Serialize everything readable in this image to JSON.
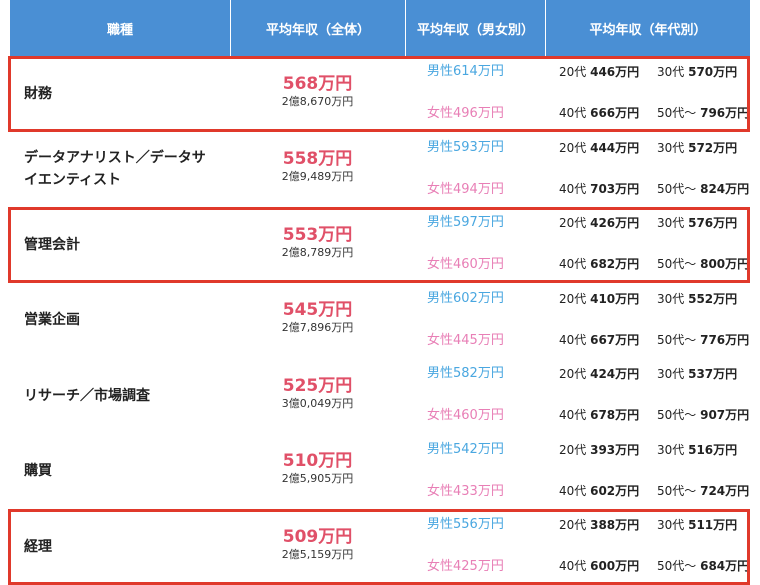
{
  "header": {
    "col1": "職種",
    "col2": "平均年収（全体）",
    "col3": "平均年収（男女別）",
    "col4": "平均年収（年代別）"
  },
  "highlight_color": "#e0392b",
  "header_color": "#4a8fd4",
  "rows": [
    {
      "name": "財務",
      "avg": "568万円",
      "lifetime": "2億8,670万円",
      "male": "男性614万円",
      "female": "女性496万円",
      "age20_label": "20代",
      "age20": "446万円",
      "age30_label": "30代",
      "age30": "570万円",
      "age40_label": "40代",
      "age40": "666万円",
      "age50_label": "50代〜",
      "age50": "796万円",
      "highlighted": true
    },
    {
      "name": "データアナリスト／データサイエンティスト",
      "avg": "558万円",
      "lifetime": "2億9,489万円",
      "male": "男性593万円",
      "female": "女性494万円",
      "age20_label": "20代",
      "age20": "444万円",
      "age30_label": "30代",
      "age30": "572万円",
      "age40_label": "40代",
      "age40": "703万円",
      "age50_label": "50代〜",
      "age50": "824万円",
      "highlighted": false
    },
    {
      "name": "管理会計",
      "avg": "553万円",
      "lifetime": "2億8,789万円",
      "male": "男性597万円",
      "female": "女性460万円",
      "age20_label": "20代",
      "age20": "426万円",
      "age30_label": "30代",
      "age30": "576万円",
      "age40_label": "40代",
      "age40": "682万円",
      "age50_label": "50代〜",
      "age50": "800万円",
      "highlighted": true
    },
    {
      "name": "営業企画",
      "avg": "545万円",
      "lifetime": "2億7,896万円",
      "male": "男性602万円",
      "female": "女性445万円",
      "age20_label": "20代",
      "age20": "410万円",
      "age30_label": "30代",
      "age30": "552万円",
      "age40_label": "40代",
      "age40": "667万円",
      "age50_label": "50代〜",
      "age50": "776万円",
      "highlighted": false
    },
    {
      "name": "リサーチ／市場調査",
      "avg": "525万円",
      "lifetime": "3億0,049万円",
      "male": "男性582万円",
      "female": "女性460万円",
      "age20_label": "20代",
      "age20": "424万円",
      "age30_label": "30代",
      "age30": "537万円",
      "age40_label": "40代",
      "age40": "678万円",
      "age50_label": "50代〜",
      "age50": "907万円",
      "highlighted": false
    },
    {
      "name": "購買",
      "avg": "510万円",
      "lifetime": "2億5,905万円",
      "male": "男性542万円",
      "female": "女性433万円",
      "age20_label": "20代",
      "age20": "393万円",
      "age30_label": "30代",
      "age30": "516万円",
      "age40_label": "40代",
      "age40": "602万円",
      "age50_label": "50代〜",
      "age50": "724万円",
      "highlighted": false
    },
    {
      "name": "経理",
      "avg": "509万円",
      "lifetime": "2億5,159万円",
      "male": "男性556万円",
      "female": "女性425万円",
      "age20_label": "20代",
      "age20": "388万円",
      "age30_label": "30代",
      "age30": "511万円",
      "age40_label": "40代",
      "age40": "600万円",
      "age50_label": "50代〜",
      "age50": "684万円",
      "highlighted": true
    }
  ]
}
